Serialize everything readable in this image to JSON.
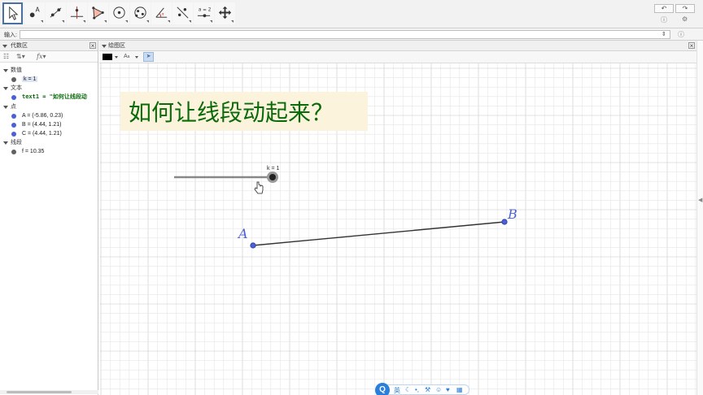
{
  "toolbar": {
    "tools": [
      "move-tool",
      "point-tool",
      "line-tool",
      "perpendicular-tool",
      "polygon-tool",
      "circle-tool",
      "conic-tool",
      "angle-tool",
      "reflect-tool",
      "slider-tool",
      "move-view-tool"
    ],
    "slider_tool_label": "a = 2",
    "undo_icon": "undo-icon",
    "redo_icon": "redo-icon",
    "help_icon": "help-icon",
    "settings_icon": "gear-icon"
  },
  "input_bar": {
    "label": "输入:",
    "value": ""
  },
  "algebra": {
    "title": "代数区",
    "categories": [
      {
        "label": "数值",
        "items": [
          {
            "text": "k = 1"
          }
        ]
      },
      {
        "label": "文本",
        "items": [
          {
            "text": "text1 = \"如何让线段动"
          }
        ]
      },
      {
        "label": "点",
        "items": [
          {
            "text": "A = (-5.86, 0.23)"
          },
          {
            "text": "B = (4.44, 1.21)"
          },
          {
            "text": "C = (4.44, 1.21)"
          }
        ]
      },
      {
        "label": "线段",
        "items": [
          {
            "text": "f = 10.35"
          }
        ]
      }
    ]
  },
  "graphics": {
    "title": "绘图区",
    "label_style": "A",
    "text_box": "如何让线段动起来？",
    "slider_label": "k = 1",
    "point_a_label": "A",
    "point_b_label": "B",
    "colors": {
      "point": "#4b5fd6",
      "text_box_bg": "#fbf3db",
      "text": "#0a6b0a",
      "grid_minor": "#e6e6e6",
      "grid_major": "#c8c8c8"
    }
  },
  "ime": {
    "logo": "Q",
    "lang": "英"
  }
}
